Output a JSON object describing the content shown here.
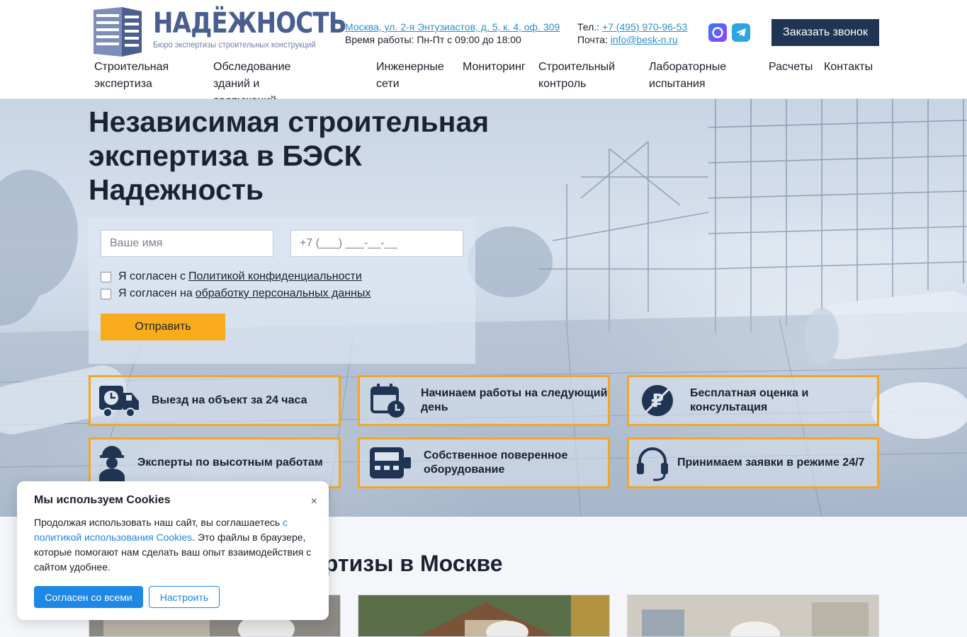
{
  "logo": {
    "title": "НАДЁЖНОСТЬ",
    "subtitle": "Бюро экспертизы строительных конструкций"
  },
  "header": {
    "address": "Москва, ул. 2-я Энтузиастов, д. 5, к. 4, оф. 309",
    "hours": "Время работы: Пн-Пт с 09:00 до 18:00",
    "phone_label": "Тел.:",
    "phone": "+7 (495) 970-96-53",
    "email_label": "Почта:",
    "email": "info@besk-n.ru",
    "callback_label": "Заказать звонок"
  },
  "nav": [
    {
      "line1": "Строительная",
      "line2": "экспертиза"
    },
    {
      "line1": "Обследование зданий и",
      "line2": "сооружений"
    },
    {
      "line1": "Инженерные",
      "line2": "сети"
    },
    {
      "line1": "Мониторинг",
      "line2": ""
    },
    {
      "line1": "Строительный",
      "line2": "контроль"
    },
    {
      "line1": "Лабораторные",
      "line2": "испытания"
    },
    {
      "line1": "Расчеты",
      "line2": ""
    },
    {
      "line1": "Контакты",
      "line2": ""
    }
  ],
  "hero": {
    "title": "Независимая строительная экспертиза в БЭСК Надежность",
    "name_placeholder": "Ваше имя",
    "phone_placeholder": "+7 (___) ___-__-__",
    "consent1_text": "Я согласен с",
    "consent1_link": "Политикой конфиденциальности",
    "consent2_text": "Я согласен на",
    "consent2_link": "обработку персональных данных",
    "submit_label": "Отправить"
  },
  "features": [
    {
      "icon": "truck-clock-icon",
      "text": "Выезд на объект за 24 часа"
    },
    {
      "icon": "calendar-clock-icon",
      "text": "Начинаем работы на следующий день"
    },
    {
      "icon": "ruble-crossed-icon",
      "text": "Бесплатная оценка и консультация"
    },
    {
      "icon": "worker-helmet-icon",
      "text": "Эксперты по высотным работам"
    },
    {
      "icon": "measuring-device-icon",
      "text": "Собственное поверенное оборудование"
    },
    {
      "icon": "headset-icon",
      "text": "Принимаем заявки в режиме 24/7"
    }
  ],
  "section": {
    "title_visible": "ертизы в Москве"
  },
  "cookie": {
    "title": "Мы используем Cookies",
    "close": "×",
    "text_before": "Продолжая использовать наш сайт, вы соглашаетесь",
    "link": "с политикой использования Cookies",
    "text_after": ". Это файлы в браузере, которые помогают нам сделать ваш опыт взаимодействия с сайтом удобнее.",
    "accept_label": "Согласен со всеми",
    "configure_label": "Настроить"
  },
  "colors": {
    "accent": "#f9ac1b",
    "dark": "#1f3553",
    "link": "#2d8fcf",
    "cookie_button": "#1e88e5"
  }
}
